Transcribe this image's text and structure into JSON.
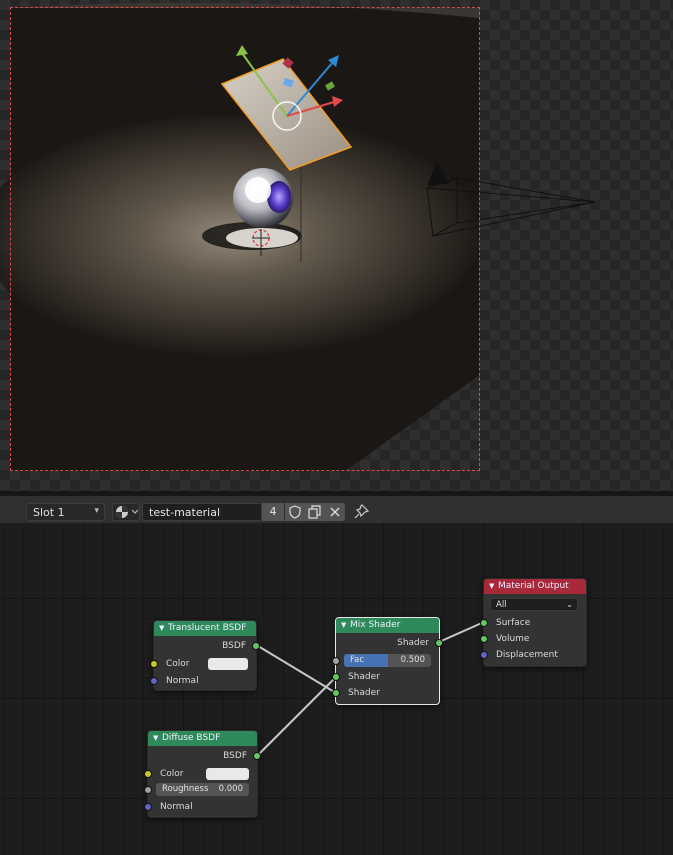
{
  "header": {
    "slot_label": "Slot 1",
    "material_name": "test-material",
    "user_count": "4"
  },
  "icons": {
    "material_type": "sphere-icon",
    "fake_user": "shield-icon",
    "duplicate": "copy-icon",
    "unlink": "close-icon",
    "pin": "pin-icon"
  },
  "nodes": {
    "translucent": {
      "title": "Translucent BSDF",
      "output": "BSDF",
      "color_label": "Color",
      "normal_label": "Normal"
    },
    "diffuse": {
      "title": "Diffuse BSDF",
      "output": "BSDF",
      "color_label": "Color",
      "roughness_label": "Roughness",
      "roughness_value": "0.000",
      "normal_label": "Normal"
    },
    "mix": {
      "title": "Mix Shader",
      "output": "Shader",
      "fac_label": "Fac",
      "fac_value": "0.500",
      "shader1_label": "Shader",
      "shader2_label": "Shader"
    },
    "output": {
      "title": "Material Output",
      "target": "All",
      "surface_label": "Surface",
      "volume_label": "Volume",
      "displacement_label": "Displacement"
    }
  },
  "colors": {
    "shader_node_header": "#2f8a5b",
    "output_node_header": "#a8293a",
    "shader_socket": "#63c763",
    "color_socket": "#c7c729",
    "vector_socket": "#6363c7",
    "camera_frame": "#d84a4a",
    "selection_outline": "#f39c28"
  }
}
